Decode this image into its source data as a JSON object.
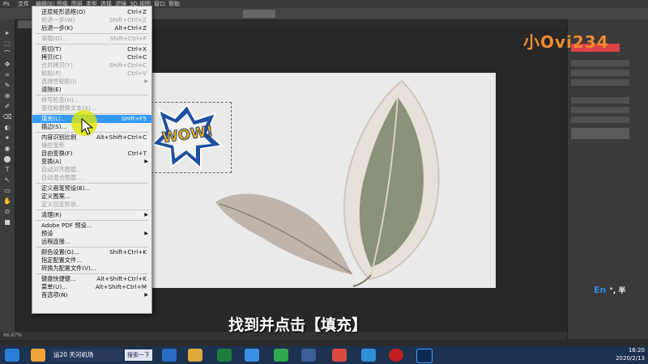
{
  "menubar": {
    "items": [
      "Ps",
      "文件",
      "编辑(E)",
      "图像",
      "图层",
      "类型",
      "选择",
      "滤镜",
      "3D",
      "视图",
      "窗口",
      "帮助"
    ]
  },
  "doc_tab": "",
  "edit_menu": {
    "items": [
      {
        "label": "还原矩形选框(O)",
        "shortcut": "Ctrl+Z",
        "disabled": false
      },
      {
        "label": "前进一步(W)",
        "shortcut": "Shift+Ctrl+Z",
        "disabled": true
      },
      {
        "label": "后退一步(K)",
        "shortcut": "Alt+Ctrl+Z",
        "disabled": false
      },
      {
        "sep": true
      },
      {
        "label": "渐隐(D)...",
        "shortcut": "Shift+Ctrl+F",
        "disabled": true
      },
      {
        "sep": true
      },
      {
        "label": "剪切(T)",
        "shortcut": "Ctrl+X",
        "disabled": false
      },
      {
        "label": "拷贝(C)",
        "shortcut": "Ctrl+C",
        "disabled": false
      },
      {
        "label": "合并拷贝(Y)",
        "shortcut": "Shift+Ctrl+C",
        "disabled": true
      },
      {
        "label": "粘贴(P)",
        "shortcut": "Ctrl+V",
        "disabled": true
      },
      {
        "label": "选择性粘贴(I)",
        "shortcut": "",
        "disabled": true,
        "submenu": true
      },
      {
        "label": "清除(E)",
        "shortcut": "",
        "disabled": false
      },
      {
        "sep": true
      },
      {
        "label": "拼写检查(H)...",
        "shortcut": "",
        "disabled": true
      },
      {
        "label": "查找和替换文本(X)...",
        "shortcut": "",
        "disabled": true
      },
      {
        "sep": true
      },
      {
        "label": "填充(L)...",
        "shortcut": "Shift+F5",
        "disabled": false,
        "highlighted": true
      },
      {
        "label": "描边(S)...",
        "shortcut": "",
        "disabled": false
      },
      {
        "sep": true
      },
      {
        "label": "内容识别比例",
        "shortcut": "Alt+Shift+Ctrl+C",
        "disabled": false
      },
      {
        "label": "操控变形",
        "shortcut": "",
        "disabled": true
      },
      {
        "label": "自由变换(F)",
        "shortcut": "Ctrl+T",
        "disabled": false
      },
      {
        "label": "变换(A)",
        "shortcut": "",
        "disabled": false,
        "submenu": true
      },
      {
        "label": "自动对齐图层...",
        "shortcut": "",
        "disabled": true
      },
      {
        "label": "自动混合图层...",
        "shortcut": "",
        "disabled": true
      },
      {
        "sep": true
      },
      {
        "label": "定义画笔预设(B)...",
        "shortcut": "",
        "disabled": false
      },
      {
        "label": "定义图案...",
        "shortcut": "",
        "disabled": false
      },
      {
        "label": "定义自定形状...",
        "shortcut": "",
        "disabled": true
      },
      {
        "sep": true
      },
      {
        "label": "清理(R)",
        "shortcut": "",
        "disabled": false,
        "submenu": true
      },
      {
        "sep": true
      },
      {
        "label": "Adobe PDF 预设...",
        "shortcut": "",
        "disabled": false
      },
      {
        "label": "预设",
        "shortcut": "",
        "disabled": false,
        "submenu": true
      },
      {
        "label": "远程连接...",
        "shortcut": "",
        "disabled": false
      },
      {
        "sep": true
      },
      {
        "label": "颜色设置(G)...",
        "shortcut": "Shift+Ctrl+K",
        "disabled": false
      },
      {
        "label": "指定配置文件...",
        "shortcut": "",
        "disabled": false
      },
      {
        "label": "转换为配置文件(V)...",
        "shortcut": "",
        "disabled": false
      },
      {
        "sep": true
      },
      {
        "label": "键盘快捷键...",
        "shortcut": "Alt+Shift+Ctrl+K",
        "disabled": false
      },
      {
        "label": "菜单(U)...",
        "shortcut": "Alt+Shift+Ctrl+M",
        "disabled": false
      },
      {
        "label": "首选项(N)",
        "shortcut": "",
        "disabled": false,
        "submenu": true
      }
    ]
  },
  "caption": "找到并点击【填充】",
  "canvas_art": {
    "wow_text": "WOW!"
  },
  "watermark": "小Ovi234",
  "ime": "En",
  "status": {
    "zoom": "66.67%",
    "doc": ""
  },
  "taskbar": {
    "search_text": "运20 天河机场",
    "search_button": "搜索一下",
    "time": "16:20",
    "date": "2020/2/13"
  }
}
